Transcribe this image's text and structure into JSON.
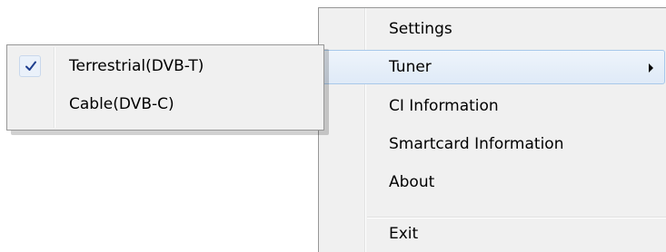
{
  "main_menu": {
    "items": [
      {
        "label": "Settings"
      },
      {
        "label": "Tuner",
        "highlighted": true,
        "has_submenu": true
      },
      {
        "label": "CI Information"
      },
      {
        "label": "Smartcard Information"
      },
      {
        "label": "About"
      },
      {
        "label": "Exit"
      }
    ]
  },
  "tuner_submenu": {
    "items": [
      {
        "label": "Terrestrial(DVB-T)",
        "checked": true
      },
      {
        "label": "Cable(DVB-C)",
        "checked": false
      }
    ]
  },
  "icons": {
    "submenu_arrow": "chevron-right-icon",
    "check": "check-icon"
  },
  "colors": {
    "menu_background": "#f0f0f0",
    "highlight_border": "#a8c8ea",
    "check_color": "#1f3f8f"
  }
}
